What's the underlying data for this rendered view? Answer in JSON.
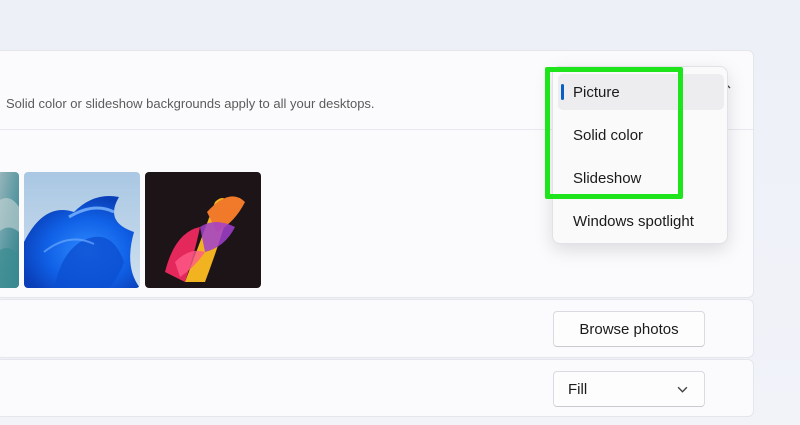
{
  "background_panel": {
    "description": "Solid color or slideshow backgrounds apply to all your desktops."
  },
  "recent_images": [
    {
      "name": "wallpaper-aqua-partial"
    },
    {
      "name": "wallpaper-blue-bloom"
    },
    {
      "name": "wallpaper-colorful-flow"
    }
  ],
  "browse": {
    "label": "Browse photos"
  },
  "fit": {
    "selected": "Fill"
  },
  "dropdown": {
    "items": [
      {
        "label": "Picture",
        "selected": true
      },
      {
        "label": "Solid color",
        "selected": false
      },
      {
        "label": "Slideshow",
        "selected": false
      },
      {
        "label": "Windows spotlight",
        "selected": false
      }
    ]
  },
  "colors": {
    "accent": "#0a5fc4",
    "highlight": "#1ee41c"
  }
}
